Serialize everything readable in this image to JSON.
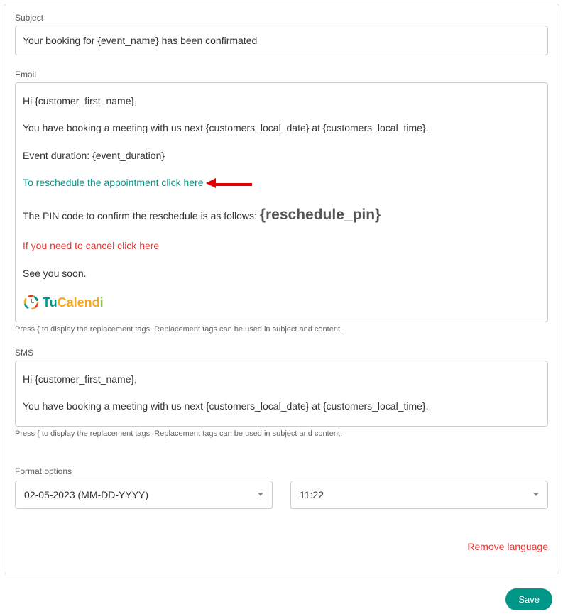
{
  "subject": {
    "label": "Subject",
    "value": "Your booking for {event_name} has been confirmated"
  },
  "email": {
    "label": "Email",
    "greeting": "Hi  {customer_first_name},",
    "line1": "You have booking a meeting with us next {customers_local_date} at {customers_local_time}.",
    "line2": "Event duration: {event_duration}",
    "reschedule_link": "To reschedule the appointment click here",
    "pin_prefix": "The PIN code to confirm the reschedule is as follows: ",
    "pin_tag": "{reschedule_pin}",
    "cancel_link": "If you need to cancel click here",
    "signoff": "See you soon.",
    "logo_tu": "Tu",
    "logo_calend": "Calend",
    "logo_i": "i"
  },
  "hint": "Press { to display the replacement tags. Replacement tags can be used in subject and content.",
  "sms": {
    "label": "SMS",
    "greeting": "Hi  {customer_first_name},",
    "line1": "You have booking a meeting with us next {customers_local_date} at {customers_local_time}."
  },
  "format": {
    "label": "Format options",
    "date_value": "02-05-2023 (MM-DD-YYYY)",
    "time_value": "11:22"
  },
  "actions": {
    "remove_language": "Remove language",
    "save": "Save"
  }
}
